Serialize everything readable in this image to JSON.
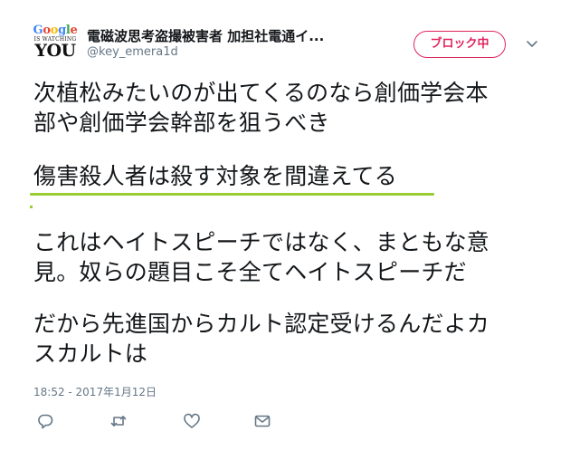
{
  "tweet": {
    "avatar": {
      "logo_letters": [
        "G",
        "o",
        "o",
        "g",
        "l",
        "e"
      ],
      "logo_colors": [
        "#4285f4",
        "#ea4335",
        "#fbbc05",
        "#4285f4",
        "#34a853",
        "#ea4335"
      ],
      "watching": "IS WATCHING",
      "you": "YOU"
    },
    "display_name": "電磁波思考盗撮被害者 加担社電通イ...",
    "screen_name": "@key_emera1d",
    "block_button_label": "ブロック中",
    "paragraphs": [
      "次植松みたいのが出てくるのなら創価学会本\n部や創価学会幹部を狙うべき",
      "傷害殺人者は殺す対象を間違えてる",
      "これはヘイトスピーチではなく、まともな意\n見。奴らの題目こそ全てヘイトスピーチだ",
      "だから先進国からカルト認定受けるんだよカ\nスカルトは"
    ],
    "timestamp": "18:52 - 2017年1月12日",
    "highlight_color": "#9acd32",
    "accent_color": "#e0245e",
    "actions": [
      {
        "icon": "reply-icon"
      },
      {
        "icon": "retweet-icon"
      },
      {
        "icon": "like-icon"
      },
      {
        "icon": "direct-message-icon"
      }
    ]
  }
}
